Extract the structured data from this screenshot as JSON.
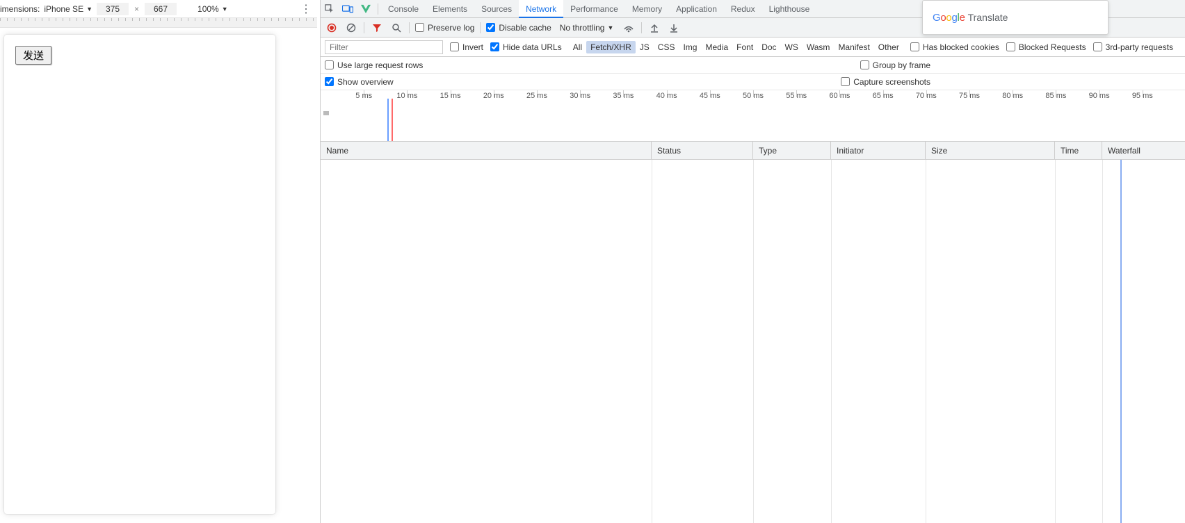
{
  "device_toolbar": {
    "dimensions_label": "imensions:",
    "device_name": "iPhone SE",
    "width": "375",
    "height": "667",
    "multiply": "×",
    "zoom": "100%"
  },
  "viewport": {
    "send_button": "发送"
  },
  "tabs": {
    "console": "Console",
    "elements": "Elements",
    "sources": "Sources",
    "network": "Network",
    "performance": "Performance",
    "memory": "Memory",
    "application": "Application",
    "redux": "Redux",
    "lighthouse": "Lighthouse"
  },
  "net_toolbar": {
    "preserve_log": "Preserve log",
    "disable_cache": "Disable cache",
    "throttling": "No throttling"
  },
  "filterbar": {
    "filter_placeholder": "Filter",
    "invert": "Invert",
    "hide_data_urls": "Hide data URLs",
    "types": {
      "all": "All",
      "fetch_xhr": "Fetch/XHR",
      "js": "JS",
      "css": "CSS",
      "img": "Img",
      "media": "Media",
      "font": "Font",
      "doc": "Doc",
      "ws": "WS",
      "wasm": "Wasm",
      "manifest": "Manifest",
      "other": "Other"
    },
    "has_blocked_cookies": "Has blocked cookies",
    "blocked_requests": "Blocked Requests",
    "third_party": "3rd-party requests"
  },
  "options": {
    "use_large_rows": "Use large request rows",
    "group_by_frame": "Group by frame",
    "show_overview": "Show overview",
    "capture_screenshots": "Capture screenshots"
  },
  "overview_ticks": [
    "5 ms",
    "10 ms",
    "15 ms",
    "20 ms",
    "25 ms",
    "30 ms",
    "35 ms",
    "40 ms",
    "45 ms",
    "50 ms",
    "55 ms",
    "60 ms",
    "65 ms",
    "70 ms",
    "75 ms",
    "80 ms",
    "85 ms",
    "90 ms",
    "95 ms"
  ],
  "columns": {
    "name": "Name",
    "status": "Status",
    "type": "Type",
    "initiator": "Initiator",
    "size": "Size",
    "time": "Time",
    "waterfall": "Waterfall"
  },
  "gt": {
    "translate": "Translate"
  }
}
